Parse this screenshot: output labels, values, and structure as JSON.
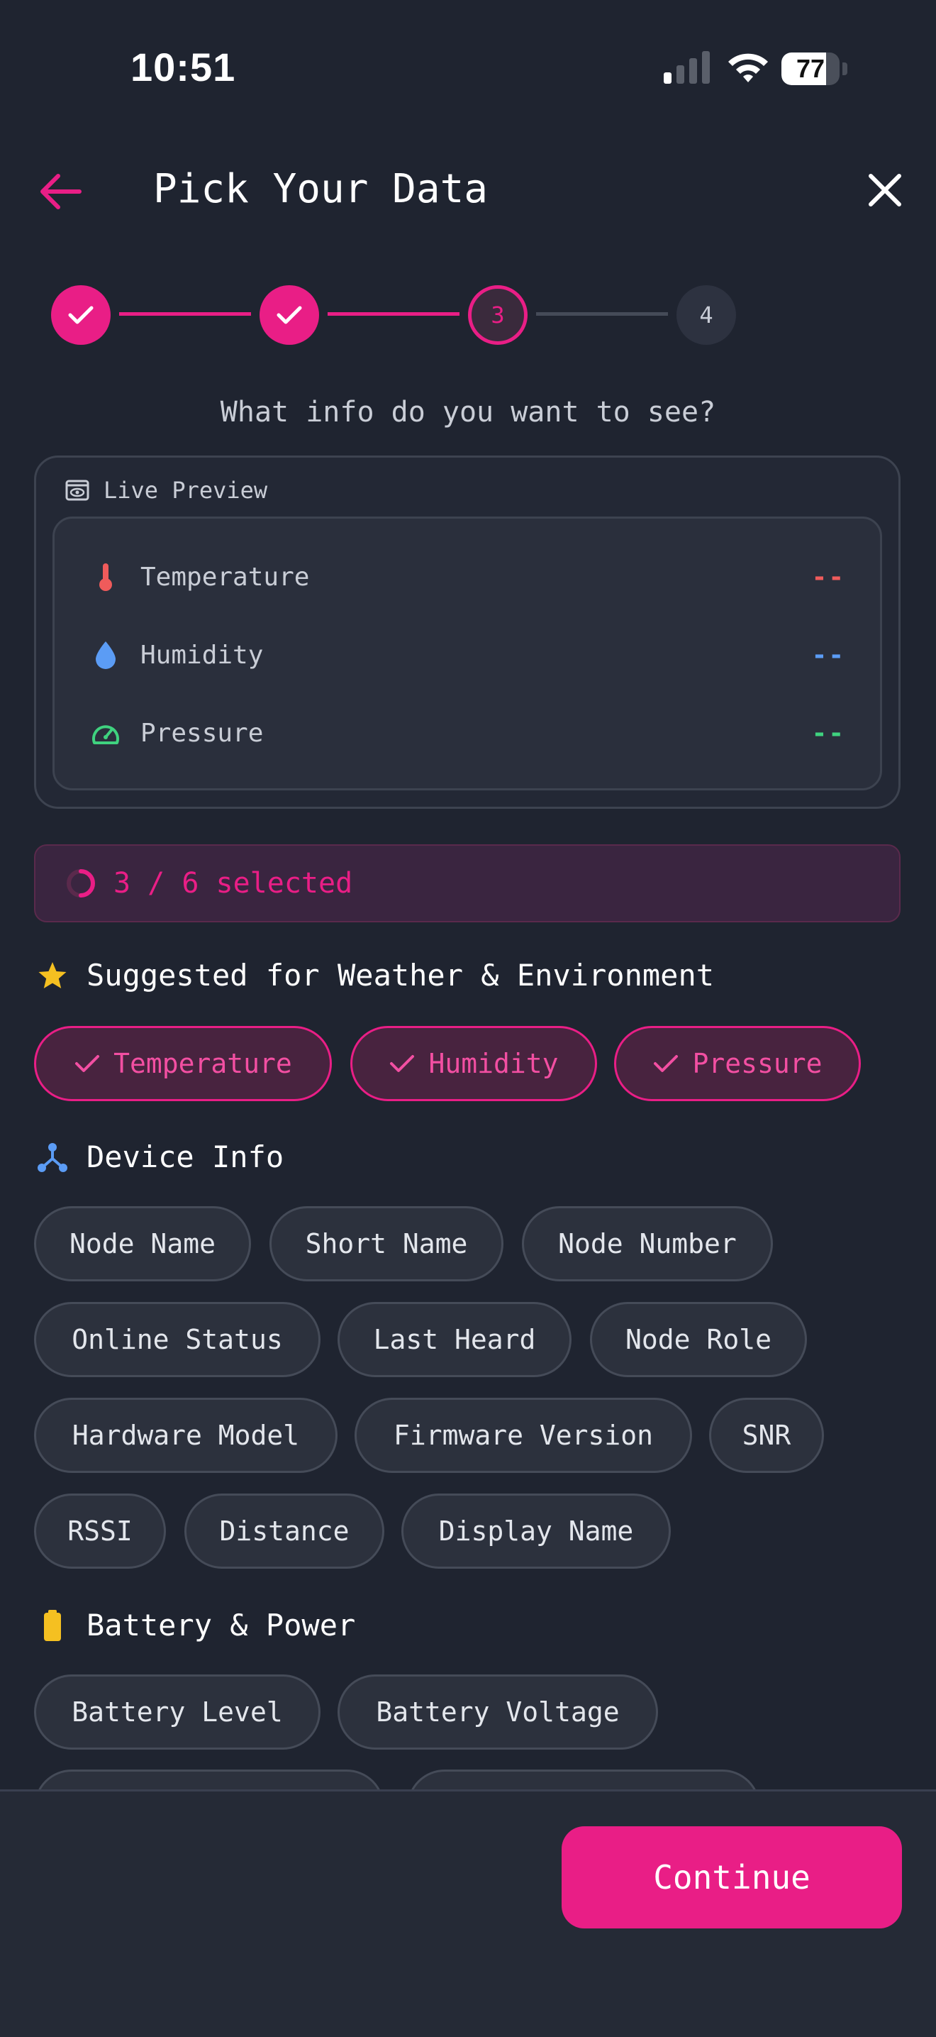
{
  "status_bar": {
    "time": "10:51",
    "battery_level": "77",
    "battery_fraction": 0.77
  },
  "header": {
    "title": "Pick Your Data"
  },
  "stepper": {
    "steps": [
      "1",
      "2",
      "3",
      "4"
    ],
    "current": 3
  },
  "question": "What info do you want to see?",
  "live_preview": {
    "label": "Live Preview",
    "rows": [
      {
        "label": "Temperature",
        "value": "--",
        "color": "#ef5b5b",
        "icon": "thermometer-icon"
      },
      {
        "label": "Humidity",
        "value": "--",
        "color": "#5b9cf5",
        "icon": "droplet-icon"
      },
      {
        "label": "Pressure",
        "value": "--",
        "color": "#3fd27f",
        "icon": "gauge-icon"
      }
    ]
  },
  "selection": {
    "text": "3 / 6 selected",
    "fraction": 0.5
  },
  "sections": {
    "suggested": {
      "title": "Suggested for Weather & Environment",
      "chips": [
        "Temperature",
        "Humidity",
        "Pressure"
      ]
    },
    "device_info": {
      "title": "Device Info",
      "chips": [
        "Node Name",
        "Short Name",
        "Node Number",
        "Online Status",
        "Last Heard",
        "Node Role",
        "Hardware Model",
        "Firmware Version",
        "SNR",
        "RSSI",
        "Distance",
        "Display Name"
      ]
    },
    "battery": {
      "title": "Battery & Power",
      "chips": [
        "Battery Level",
        "Battery Voltage"
      ]
    }
  },
  "footer": {
    "continue_label": "Continue"
  },
  "colors": {
    "accent": "#e91e86",
    "background": "#1f2430",
    "star": "#f5c021",
    "device_icon": "#5b9cf5",
    "battery_icon": "#f5c021"
  }
}
